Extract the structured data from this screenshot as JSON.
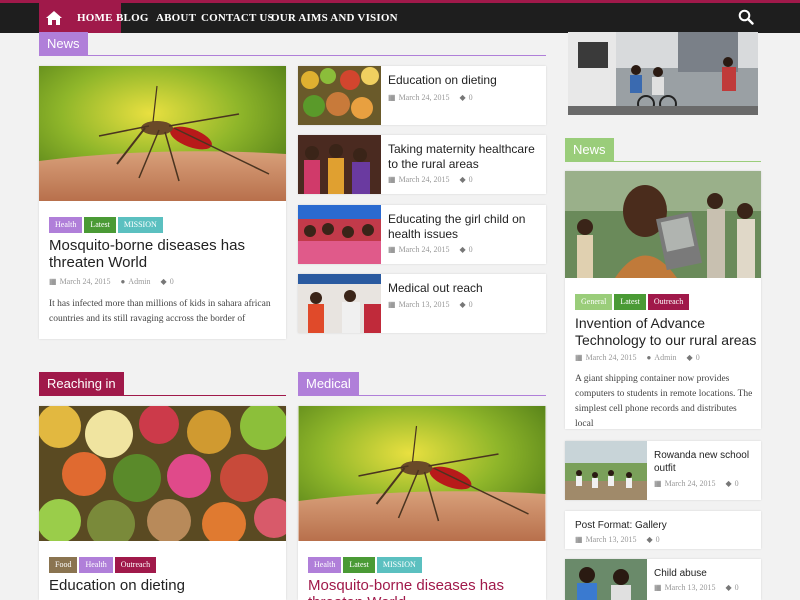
{
  "nav": {
    "home_icon": "home-icon",
    "items": [
      "HOME",
      "BLOG",
      "ABOUT",
      "CONTACT US",
      "OUR AIMS AND VISION"
    ],
    "search_icon": "search-icon"
  },
  "colors": {
    "accent": "#a0194a",
    "purple": "#b07fd9",
    "green": "#9acd7a",
    "dark_green": "#4a9a35",
    "teal": "#5bc0c0",
    "brown": "#8a7450",
    "crimson": "#a0194a"
  },
  "news_section": {
    "label": "News",
    "featured": {
      "tags": [
        "Health",
        "Latest",
        "MISSION"
      ],
      "title": "Mosquito-borne diseases has threaten World",
      "date": "March 24, 2015",
      "author": "Admin",
      "comments": "0",
      "excerpt": "It has infected more than millions of kids in sahara african countries and its still ravaging accross the border of"
    },
    "list": [
      {
        "title": "Education on dieting",
        "date": "March 24, 2015",
        "comments": "0"
      },
      {
        "title": "Taking maternity healthcare to the rural areas",
        "date": "March 24, 2015",
        "comments": "0"
      },
      {
        "title": "Educating the girl child on health issues",
        "date": "March 24, 2015",
        "comments": "0"
      },
      {
        "title": "Medical out reach",
        "date": "March 13, 2015",
        "comments": "0"
      }
    ]
  },
  "reaching_section": {
    "label": "Reaching in",
    "tags": [
      "Food",
      "Health",
      "Outreach"
    ],
    "title": "Education on dieting"
  },
  "medical_section": {
    "label": "Medical",
    "tags": [
      "Health",
      "Latest",
      "MISSION"
    ],
    "title": "Mosquito-borne diseases has threaten World"
  },
  "sidebar": {
    "news_label": "News",
    "featured": {
      "tags": [
        "General",
        "Latest",
        "Outreach"
      ],
      "title": "Invention of Advance Technology to our rural areas",
      "date": "March 24, 2015",
      "author": "Admin",
      "comments": "0",
      "excerpt": "A giant shipping container now provides computers to students in remote locations. The simplest cell phone records and distributes local"
    },
    "list": [
      {
        "title": "Rowanda new school outfit",
        "date": "March 24, 2015",
        "comments": "0"
      },
      {
        "title": "Post Format: Gallery",
        "date": "March 13, 2015",
        "comments": "0"
      },
      {
        "title": "Child abuse",
        "date": "March 13, 2015",
        "comments": "0"
      }
    ]
  }
}
